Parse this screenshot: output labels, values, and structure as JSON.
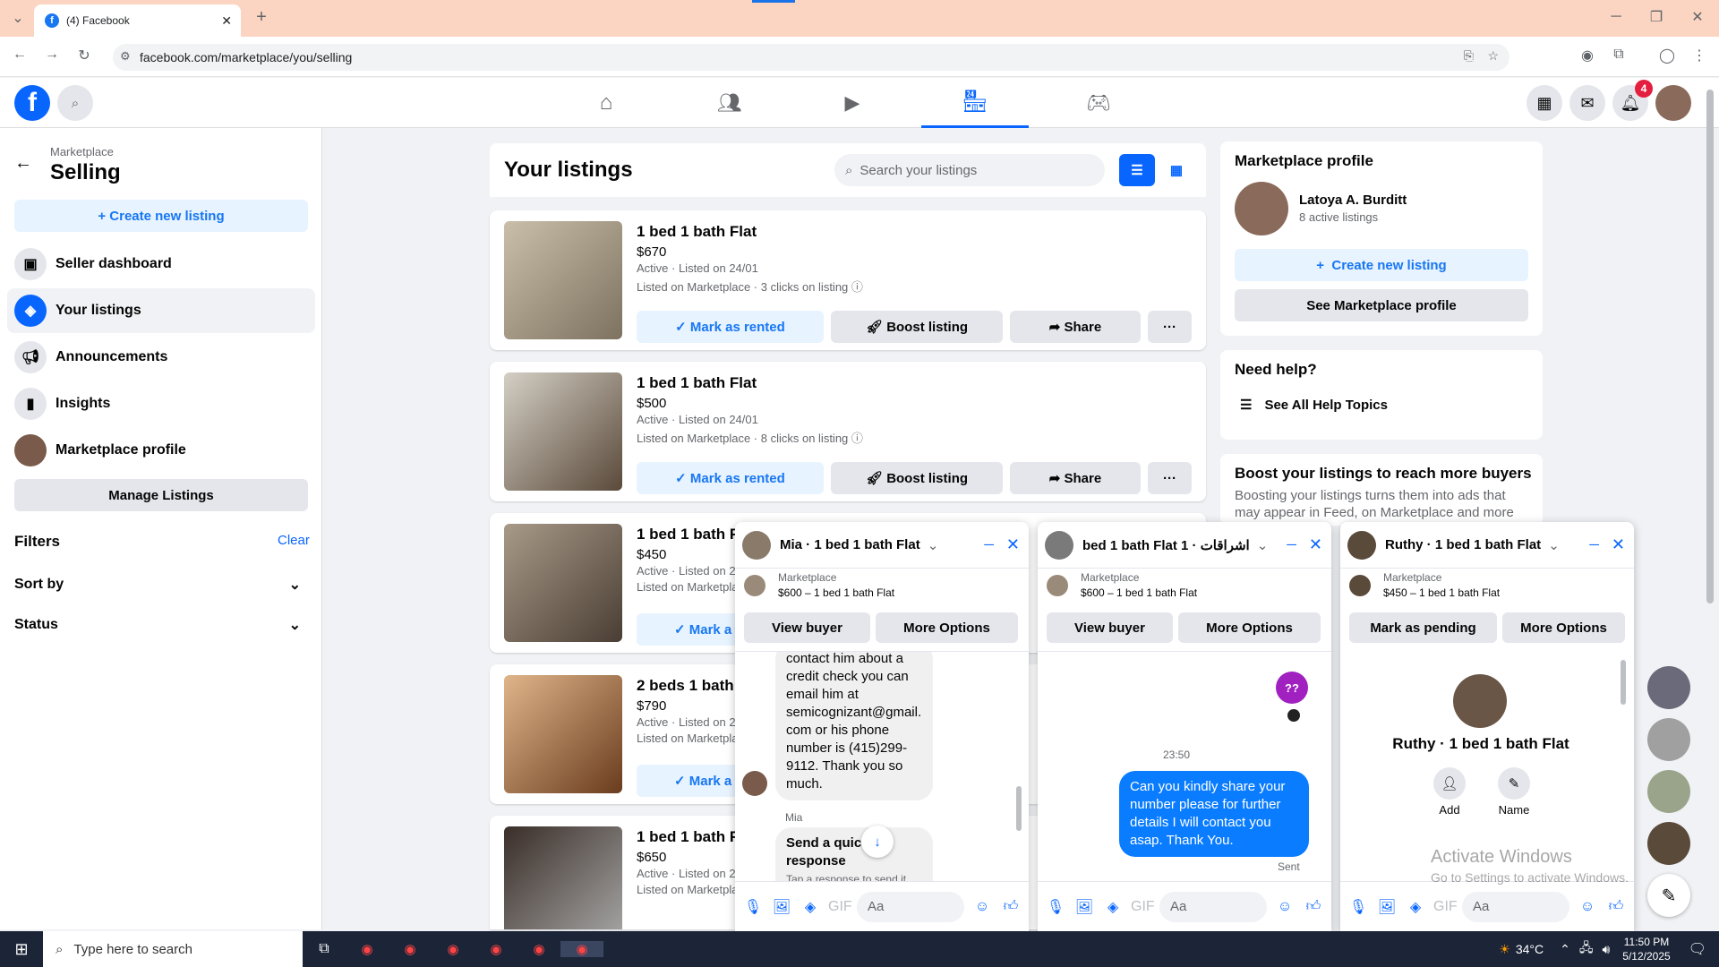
{
  "browser": {
    "tab_title": "(4) Facebook",
    "url": "facebook.com/marketplace/you/selling"
  },
  "nav": {
    "notif_count": "4"
  },
  "sidebar": {
    "crumb": "Marketplace",
    "title": "Selling",
    "create": "+ Create new listing",
    "items": [
      {
        "label": "Seller dashboard"
      },
      {
        "label": "Your listings"
      },
      {
        "label": "Announcements"
      },
      {
        "label": "Insights"
      },
      {
        "label": "Marketplace profile"
      }
    ],
    "manage": "Manage Listings",
    "filters": "Filters",
    "clear": "Clear",
    "sortby": "Sort by",
    "status": "Status"
  },
  "main": {
    "heading": "Your listings",
    "search_placeholder": "Search your listings",
    "listings": [
      {
        "title": "1 bed 1 bath Flat",
        "price": "$670",
        "status": "Active · Listed on 24/01",
        "meta": "Listed on Marketplace · 3 clicks on listing"
      },
      {
        "title": "1 bed 1 bath Flat",
        "price": "$500",
        "status": "Active · Listed on 24/01",
        "meta": "Listed on Marketplace · 8 clicks on listing"
      },
      {
        "title": "1 bed 1 bath Fl",
        "price": "$450",
        "status": "Active · Listed on 2",
        "meta": "Listed on Marketpla"
      },
      {
        "title": "2 beds 1 bath l",
        "price": "$790",
        "status": "Active · Listed on 2",
        "meta": "Listed on Marketpla"
      },
      {
        "title": "1 bed 1 bath Fl",
        "price": "$650",
        "status": "Active · Listed on 2",
        "meta": "Listed on Marketpla"
      }
    ],
    "mark_rented": "Mark as rented",
    "mark_short": "Mark a",
    "boost": "Boost listing",
    "share": "Share"
  },
  "right": {
    "profile_heading": "Marketplace profile",
    "name": "Latoya A. Burditt",
    "active": "8 active listings",
    "create": "Create new listing",
    "see_profile": "See Marketplace profile",
    "help_heading": "Need help?",
    "help_link": "See All Help Topics",
    "boost_heading": "Boost your listings to reach more buyers",
    "boost_text": "Boosting your listings turns them into ads that may appear in Feed, on Marketplace and more"
  },
  "chats": [
    {
      "title": "Mia · 1 bed 1 bath Flat",
      "ctx_label": "Marketplace",
      "ctx_item": "$600 – 1 bed 1 bath Flat",
      "btn1": "View buyer",
      "btn2": "More Options",
      "msg": "contact him about a credit check you can email him at semicognizant@gmail. com or his phone number is (415)299-9112. Thank you so much.",
      "sender": "Mia",
      "quick": "Send a quick response",
      "quick_sub": "Tap a response to send it",
      "input": "Aa"
    },
    {
      "title": "bed 1 bath Flat 1 · اشراقات",
      "ctx_label": "Marketplace",
      "ctx_item": "$600 – 1 bed 1 bath Flat",
      "btn1": "View buyer",
      "btn2": "More Options",
      "badge": "??",
      "time": "23:50",
      "me": "Can you kindly share your number please for further details I will contact you asap. Thank You.",
      "sent": "Sent",
      "input": "Aa"
    },
    {
      "title": "Ruthy · 1 bed 1 bath Flat",
      "ctx_label": "Marketplace",
      "ctx_item": "$450 – 1 bed 1 bath Flat",
      "btn1": "Mark as pending",
      "btn2": "More Options",
      "name": "Ruthy · 1 bed 1 bath Flat",
      "add": "Add",
      "nm": "Name",
      "input": "Aa"
    }
  ],
  "watermark": {
    "l1": "Activate Windows",
    "l2": "Go to Settings to activate Windows."
  },
  "taskbar": {
    "search": "Type here to search",
    "temp": "34°C",
    "time": "11:50 PM",
    "date": "5/12/2025"
  }
}
